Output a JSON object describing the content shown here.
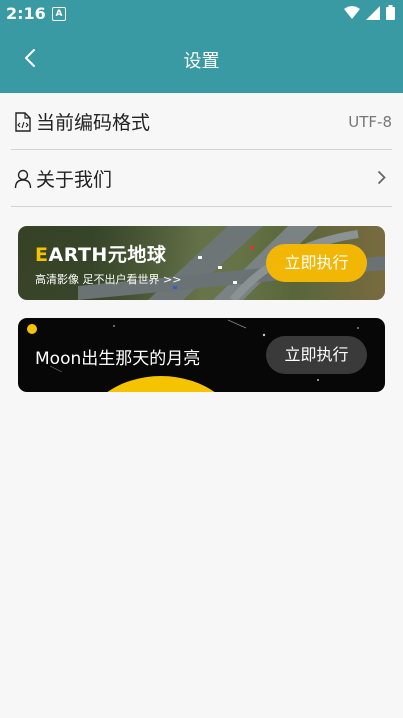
{
  "status_bar": {
    "time": "2:16",
    "notification_badge": "A"
  },
  "app_bar": {
    "title": "设置"
  },
  "settings": {
    "encoding": {
      "label": "当前编码格式",
      "value": "UTF-8"
    },
    "about": {
      "label": "关于我们"
    }
  },
  "banners": {
    "earth": {
      "title_initial": "E",
      "title_rest": "ARTH元地球",
      "subtitle": "高清影像 足不出户看世界 >>",
      "button": "立即执行"
    },
    "moon": {
      "title": "Moon出生那天的月亮",
      "button": "立即执行"
    }
  },
  "colors": {
    "primary": "#3a9aa3",
    "earth_button": "#f2b705",
    "moon_button": "#3a3a3a",
    "moon": "#f5c300"
  }
}
